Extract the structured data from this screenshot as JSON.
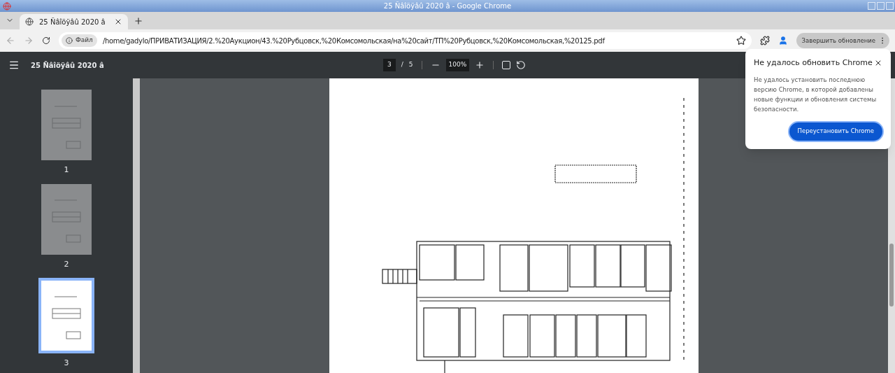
{
  "window": {
    "title": "25 Ñâîöÿâû 2020 â - Google Chrome"
  },
  "tabs": [
    {
      "title": "25 Ñâîöÿâû 2020 â",
      "selected": true
    }
  ],
  "address_bar": {
    "chip": "Файл",
    "url": "/home/gadylo/ПРИВАТИЗАЦИЯ/2.%20Аукцион/43.%20Рубцовск,%20Комсомольская/на%20сайт/ТП%20Рубцовск,%20Комсомольская,%20125.pdf"
  },
  "update_button": {
    "label": "Завершить обновление"
  },
  "pdf_toolbar": {
    "title": "25 Ñâîöÿâû 2020 â",
    "page": "3",
    "separator": "/",
    "page_count": "5",
    "zoom": "100%"
  },
  "thumbnails": [
    {
      "label": "1",
      "selected": false
    },
    {
      "label": "2",
      "selected": false
    },
    {
      "label": "3",
      "selected": true
    }
  ],
  "popup": {
    "title": "Не удалось обновить Chrome",
    "body": "Не удалось установить последнюю версию Chrome, в которой добавлены новые функции и обновления системы безопасности.",
    "button": "Переустановить Chrome"
  }
}
